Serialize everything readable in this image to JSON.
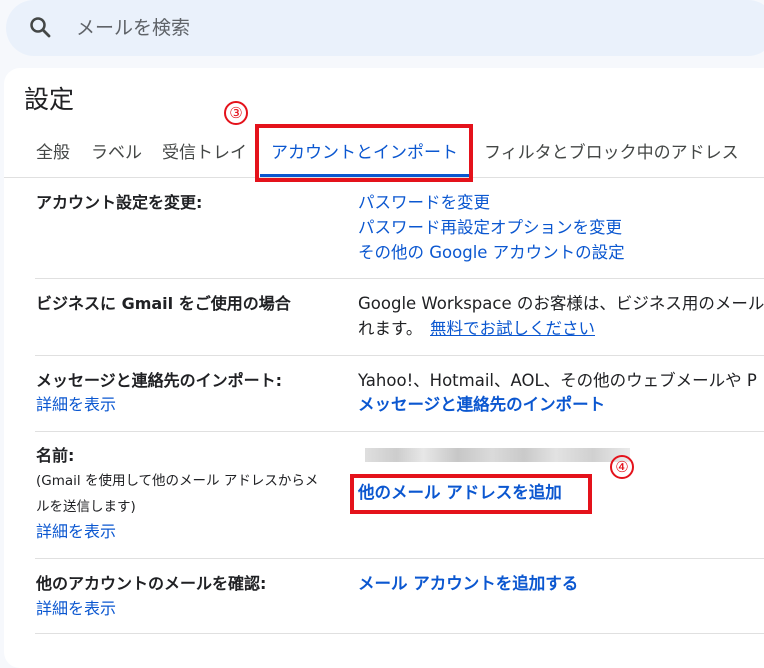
{
  "search": {
    "placeholder": "メールを検索",
    "icon": "search-icon"
  },
  "page": {
    "title": "設定"
  },
  "tabs": [
    {
      "label": "全般"
    },
    {
      "label": "ラベル"
    },
    {
      "label": "受信トレイ"
    },
    {
      "label": "アカウントとインポート",
      "active": true
    },
    {
      "label": "フィルタとブロック中のアドレス"
    }
  ],
  "annotations": {
    "step3": "③",
    "step4": "④",
    "color": "#e4121b"
  },
  "sections": {
    "change_account": {
      "label": "アカウント設定を変更:",
      "links": [
        "パスワードを変更",
        "パスワード再設定オプションを変更",
        "その他の Google アカウントの設定"
      ]
    },
    "business": {
      "label": "ビジネスに Gmail をご使用の場合",
      "text_line1": "Google Workspace のお客様は、ビジネス用のメール",
      "text_line2": "れます。",
      "link": "無料でお試しください"
    },
    "import": {
      "label": "メッセージと連絡先のインポート:",
      "details": "詳細を表示",
      "text": "Yahoo!、Hotmail、AOL、その他のウェブメールや P",
      "link": "メッセージと連絡先のインポート"
    },
    "name": {
      "label": "名前:",
      "desc_line1": "(Gmail を使用して他のメール アドレスからメ",
      "desc_line2": "ルを送信します)",
      "details": "詳細を表示",
      "link": "他のメール アドレスを追加"
    },
    "check_mail": {
      "label": "他のアカウントのメールを確認:",
      "details": "詳細を表示",
      "link": "メール アカウントを追加する"
    }
  },
  "colors": {
    "accent": "#0b57d0",
    "background": "#f6f8fc",
    "search_bg": "#eaf1fb"
  }
}
